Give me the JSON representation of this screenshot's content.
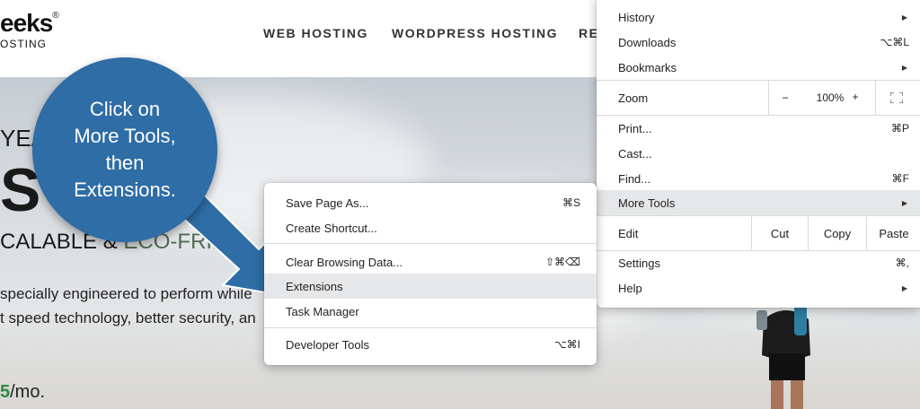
{
  "site": {
    "logo_text": "eeks",
    "logo_reg": "®",
    "logo_sub": "OSTING",
    "nav": [
      "WEB HOSTING",
      "WORDPRESS HOSTING",
      "RE"
    ],
    "hero": {
      "line1": "YEA",
      "line2": "S",
      "line3a": "CALABLE & ",
      "line3b": "ECO-FRIE",
      "body1": " specially engineered to perform while",
      "body2": "t speed technology, better security, an",
      "price_num": "5",
      "price_unit": "/mo."
    }
  },
  "callout": {
    "text": "Click on\nMore Tools,\nthen\nExtensions."
  },
  "chrome_menu": {
    "items": {
      "history": "History",
      "downloads": "Downloads",
      "downloads_sc": "⌥⌘L",
      "bookmarks": "Bookmarks",
      "zoom": "Zoom",
      "zoom_minus": "−",
      "zoom_level": "100%",
      "zoom_plus": "+",
      "print": "Print...",
      "print_sc": "⌘P",
      "cast": "Cast...",
      "find": "Find...",
      "find_sc": "⌘F",
      "more_tools": "More Tools",
      "edit": "Edit",
      "cut": "Cut",
      "copy": "Copy",
      "paste": "Paste",
      "settings": "Settings",
      "settings_sc": "⌘,",
      "help": "Help"
    }
  },
  "more_tools_menu": {
    "save_page": "Save Page As...",
    "save_page_sc": "⌘S",
    "create_shortcut": "Create Shortcut...",
    "clear_data": "Clear Browsing Data...",
    "clear_data_sc": "⇧⌘⌫",
    "extensions": "Extensions",
    "task_manager": "Task Manager",
    "dev_tools": "Developer Tools",
    "dev_tools_sc": "⌥⌘I"
  },
  "colors": {
    "callout": "#2e6da6",
    "highlight": "#e6e7e9",
    "eco_green": "#4f6b52",
    "price_green": "#2c8a3c"
  }
}
